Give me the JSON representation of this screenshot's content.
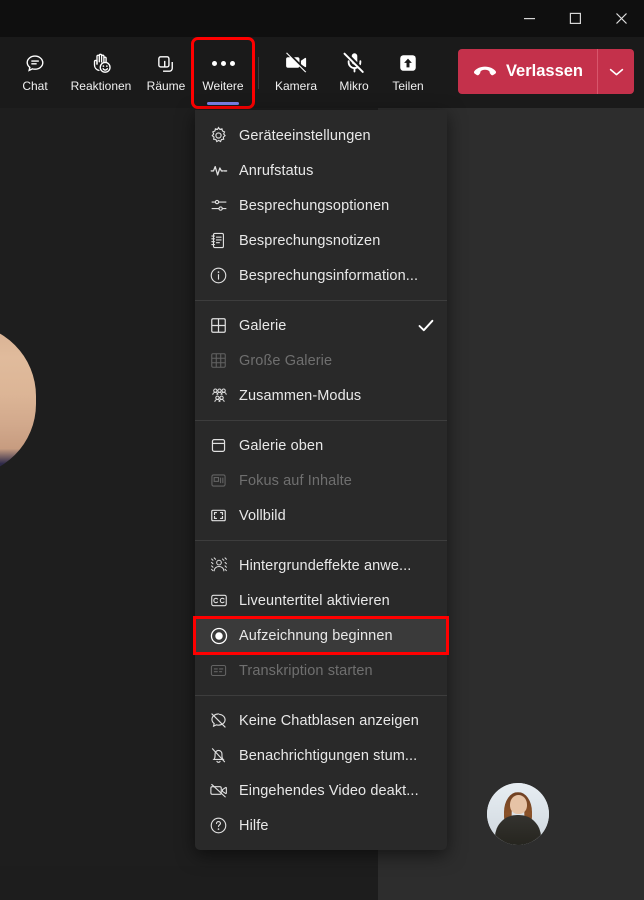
{
  "window": {
    "controls": [
      {
        "name": "minimize",
        "glyph": "minimize-icon",
        "label": "Minimieren"
      },
      {
        "name": "maximize",
        "glyph": "maximize-icon",
        "label": "Maximieren"
      },
      {
        "name": "close",
        "glyph": "close-icon",
        "label": "Schließen"
      }
    ]
  },
  "toolbar": {
    "items": [
      {
        "label": "Chat",
        "icon": "chat-icon",
        "state": "normal"
      },
      {
        "label": "Reaktionen",
        "icon": "reactions-icon",
        "state": "normal"
      },
      {
        "label": "Räume",
        "icon": "breakout-rooms-icon",
        "state": "normal"
      },
      {
        "label": "Weitere",
        "icon": "more-options-icon",
        "state": "active"
      },
      {
        "label": "Kamera",
        "icon": "camera-off-icon",
        "state": "off"
      },
      {
        "label": "Mikro",
        "icon": "microphone-off-icon",
        "state": "off"
      },
      {
        "label": "Teilen",
        "icon": "share-screen-icon",
        "state": "normal"
      }
    ],
    "leave": {
      "label": "Verlassen",
      "icon": "hangup-icon",
      "caret_icon": "chevron-down-icon",
      "color": "#c4314b"
    }
  },
  "menu": {
    "groups": [
      {
        "items": [
          {
            "label": "Geräteeinstellungen",
            "icon": "gear-icon",
            "disabled": false,
            "checked": false,
            "highlighted": false
          },
          {
            "label": "Anrufstatus",
            "icon": "call-health-icon",
            "disabled": false,
            "checked": false,
            "highlighted": false
          },
          {
            "label": "Besprechungsoptionen",
            "icon": "sliders-icon",
            "disabled": false,
            "checked": false,
            "highlighted": false
          },
          {
            "label": "Besprechungsnotizen",
            "icon": "notes-icon",
            "disabled": false,
            "checked": false,
            "highlighted": false
          },
          {
            "label": "Besprechungsinformation...",
            "icon": "info-icon",
            "disabled": false,
            "checked": false,
            "highlighted": false
          }
        ]
      },
      {
        "items": [
          {
            "label": "Galerie",
            "icon": "gallery-icon",
            "disabled": false,
            "checked": true,
            "highlighted": false
          },
          {
            "label": "Große Galerie",
            "icon": "large-gallery-icon",
            "disabled": true,
            "checked": false,
            "highlighted": false
          },
          {
            "label": "Zusammen-Modus",
            "icon": "together-mode-icon",
            "disabled": false,
            "checked": false,
            "highlighted": false
          }
        ]
      },
      {
        "items": [
          {
            "label": "Galerie oben",
            "icon": "gallery-top-icon",
            "disabled": false,
            "checked": false,
            "highlighted": false
          },
          {
            "label": "Fokus auf Inhalte",
            "icon": "focus-content-icon",
            "disabled": true,
            "checked": false,
            "highlighted": false
          },
          {
            "label": "Vollbild",
            "icon": "fullscreen-icon",
            "disabled": false,
            "checked": false,
            "highlighted": false
          }
        ]
      },
      {
        "items": [
          {
            "label": "Hintergrundeffekte anwe...",
            "icon": "background-effects-icon",
            "disabled": false,
            "checked": false,
            "highlighted": false
          },
          {
            "label": "Liveuntertitel aktivieren",
            "icon": "closed-captions-icon",
            "disabled": false,
            "checked": false,
            "highlighted": false
          },
          {
            "label": "Aufzeichnung beginnen",
            "icon": "record-icon",
            "disabled": false,
            "checked": false,
            "highlighted": true
          },
          {
            "label": "Transkription starten",
            "icon": "transcription-icon",
            "disabled": true,
            "checked": false,
            "highlighted": false
          }
        ]
      },
      {
        "items": [
          {
            "label": "Keine Chatblasen anzeigen",
            "icon": "chat-bubbles-off-icon",
            "disabled": false,
            "checked": false,
            "highlighted": false
          },
          {
            "label": "Benachrichtigungen stum...",
            "icon": "bell-off-icon",
            "disabled": false,
            "checked": false,
            "highlighted": false
          },
          {
            "label": "Eingehendes Video deakt...",
            "icon": "incoming-video-off-icon",
            "disabled": false,
            "checked": false,
            "highlighted": false
          },
          {
            "label": "Hilfe",
            "icon": "help-icon",
            "disabled": false,
            "checked": false,
            "highlighted": false
          }
        ]
      }
    ]
  },
  "stage": {
    "participant_tile": {
      "avatar_alt": "participant-avatar"
    },
    "speaker_avatar_alt": "speaker-avatar-partial"
  },
  "colors": {
    "menu_background": "#292929",
    "toolbar_background": "#1a1a1a",
    "highlight_outline": "#ff0000",
    "accent_underline": "#7b83eb",
    "leave_red": "#c4314b"
  }
}
